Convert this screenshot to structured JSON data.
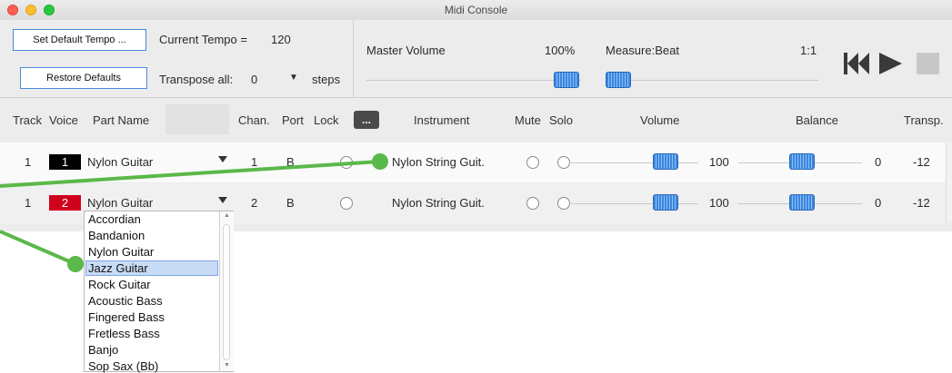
{
  "window": {
    "title": "Midi Console"
  },
  "toolbar": {
    "set_tempo_label": "Set Default Tempo ...",
    "restore_label": "Restore Defaults",
    "current_tempo_label": "Current Tempo =",
    "current_tempo_value": "120",
    "transpose_label": "Transpose all:",
    "transpose_value": "0",
    "steps_label": "steps",
    "master_volume_label": "Master Volume",
    "master_volume_value": "100%",
    "measure_label": "Measure:Beat",
    "measure_value": "1:1"
  },
  "table": {
    "headers": {
      "track": "Track",
      "voice": "Voice",
      "part": "Part Name",
      "chan": "Chan.",
      "port": "Port",
      "lock": "Lock",
      "more": "...",
      "instrument": "Instrument",
      "mute": "Mute",
      "solo": "Solo",
      "volume": "Volume",
      "balance": "Balance",
      "transp": "Transp."
    },
    "rows": [
      {
        "track": "1",
        "voice": "1",
        "voice_color": "#000000",
        "part": "Nylon Guitar",
        "chan": "1",
        "port": "B",
        "instrument": "Nylon String Guit.",
        "volume": "100",
        "balance": "0",
        "transp": "-12"
      },
      {
        "track": "1",
        "voice": "2",
        "voice_color": "#d0021b",
        "part": "Nylon Guitar",
        "chan": "2",
        "port": "B",
        "instrument": "Nylon String Guit.",
        "volume": "100",
        "balance": "0",
        "transp": "-12"
      }
    ]
  },
  "dropdown": {
    "selected_index": 3,
    "options": [
      "Accordian",
      "Bandanion",
      "Nylon Guitar",
      "Jazz Guitar",
      "Rock Guitar",
      "Acoustic Bass",
      "Fingered Bass",
      "Fretless Bass",
      "Banjo",
      "Sop Sax (Bb)"
    ]
  },
  "colors": {
    "accent": "#3b86e0",
    "callout": "#5bb84a"
  }
}
